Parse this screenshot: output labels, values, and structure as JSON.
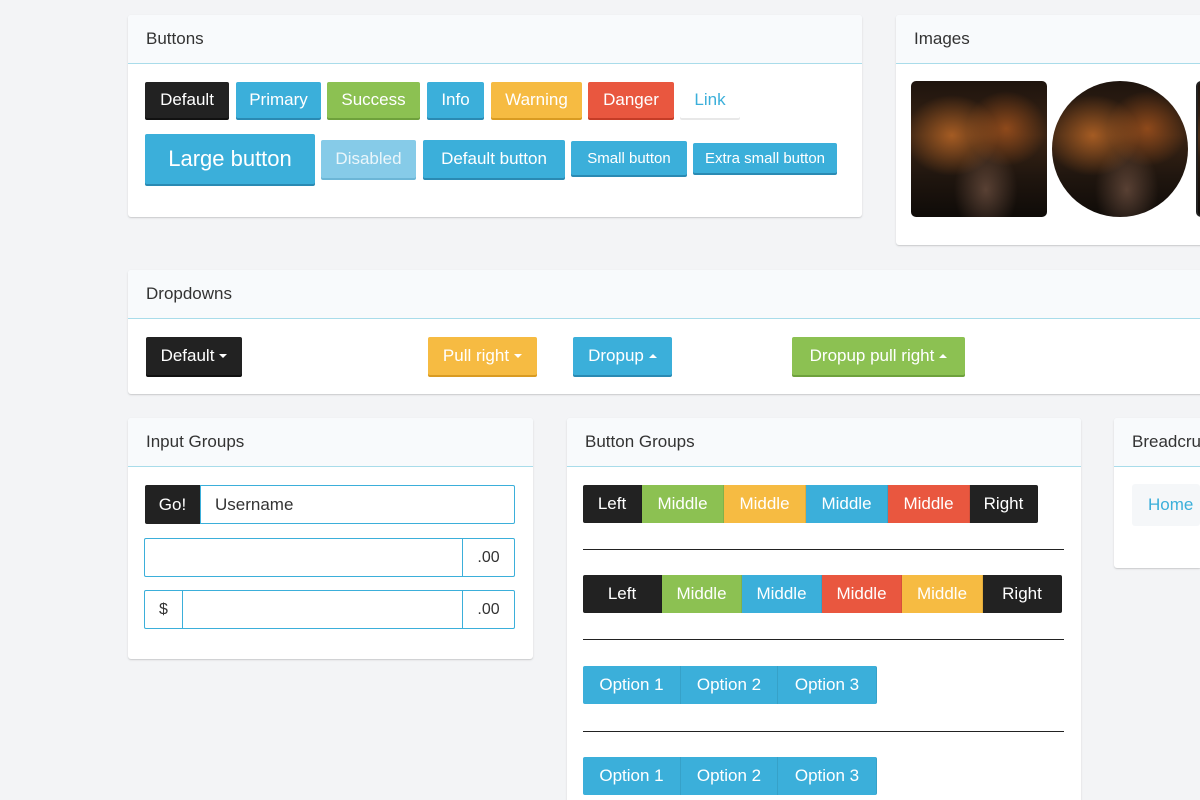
{
  "panels": {
    "buttons": {
      "title": "Buttons"
    },
    "images": {
      "title": "Images"
    },
    "dropdowns": {
      "title": "Dropdowns"
    },
    "input_groups": {
      "title": "Input Groups"
    },
    "button_groups": {
      "title": "Button Groups"
    },
    "breadcrumbs": {
      "title": "Breadcrumbs"
    }
  },
  "buttons": {
    "default": "Default",
    "primary": "Primary",
    "success": "Success",
    "info": "Info",
    "warning": "Warning",
    "danger": "Danger",
    "link": "Link",
    "large": "Large button",
    "disabled": "Disabled",
    "default_button": "Default button",
    "small": "Small button",
    "extra_small": "Extra small button"
  },
  "dropdowns": {
    "default": "Default",
    "pull_right": "Pull right",
    "dropup": "Dropup",
    "dropup_pull_right": "Dropup pull right"
  },
  "input_groups": {
    "go": "Go!",
    "username_placeholder": "Username",
    "cents": ".00",
    "dollar": "$"
  },
  "button_groups": {
    "row1": [
      "Left",
      "Middle",
      "Middle",
      "Middle",
      "Middle",
      "Right"
    ],
    "row2": [
      "Left",
      "Middle",
      "Middle",
      "Middle",
      "Middle",
      "Right"
    ],
    "options1": [
      "Option 1",
      "Option 2",
      "Option 3"
    ],
    "options2": [
      "Option 1",
      "Option 2",
      "Option 3"
    ]
  },
  "breadcrumbs": {
    "home": "Home"
  },
  "colors": {
    "default": "#222222",
    "primary": "#3bafda",
    "success": "#8cc152",
    "warning": "#f6bb42",
    "danger": "#e9573f"
  }
}
